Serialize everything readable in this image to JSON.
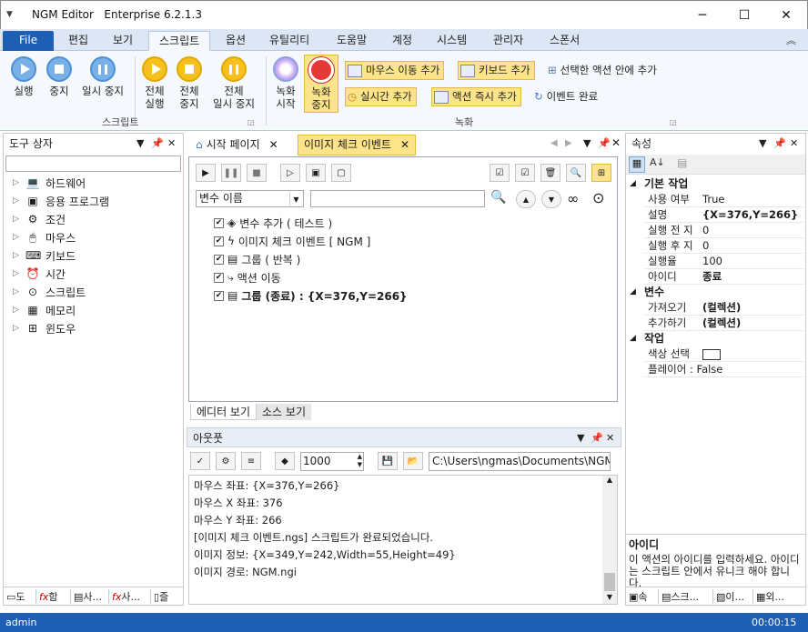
{
  "window": {
    "app_name": "NGM Editor",
    "edition": "Enterprise 6.2.1.3",
    "minimize": "─",
    "maximize": "☐",
    "close": "✕"
  },
  "ribbon_tabs": [
    "File",
    "편집",
    "보기",
    "스크립트",
    "옵션",
    "유틸리티",
    "도움말",
    "계정",
    "시스템",
    "관리자",
    "스폰서"
  ],
  "ribbon": {
    "script_group": {
      "label": "스크립트",
      "run": "실행",
      "stop": "중지",
      "pause": "일시 중지",
      "run_all": [
        "전체",
        "실행"
      ],
      "stop_all": [
        "전체",
        "중지"
      ],
      "pause_all": [
        "전체",
        "일시 중지"
      ]
    },
    "record_group": {
      "label": "녹화",
      "record_start": [
        "녹화",
        "시작"
      ],
      "record_stop": [
        "녹화",
        "중지"
      ],
      "add_mouse_move": "마우스 이동 추가",
      "add_keyboard": "키보드 추가",
      "add_in_selected_action": "선택한 액션 안에 추가",
      "add_realtime": "실시간 추가",
      "add_action_now": "액션 즉시 추가",
      "event_complete": "이벤트 완료"
    }
  },
  "left_panel": {
    "title": "도구 상자",
    "items": [
      "하드웨어",
      "응용 프로그램",
      "조건",
      "마우스",
      "키보드",
      "시간",
      "스크립트",
      "메모리",
      "윈도우"
    ],
    "bottom_tabs": [
      "도",
      "함",
      "사...",
      "사...",
      "즐"
    ]
  },
  "editor": {
    "tabs": [
      "시작 페이지",
      "이미지 체크 이벤트"
    ],
    "variable_select": "변수 이름",
    "actions": [
      {
        "label": "변수 추가 ( 테스트 )",
        "bold": false,
        "icon": "cube-icon"
      },
      {
        "label": "이미지 체크 이벤트 [ NGM ]",
        "bold": false,
        "icon": "lightning-icon"
      },
      {
        "label": "그룹 ( 반복 )",
        "bold": false,
        "icon": "group-icon"
      },
      {
        "label": "액션 이동",
        "bold": false,
        "icon": "move-icon"
      },
      {
        "label": "그룹 (종료) : {X=376,Y=266}",
        "bold": true,
        "icon": "group-icon"
      }
    ],
    "bottom_tabs": [
      "에디터 보기",
      "소스 보기"
    ]
  },
  "output": {
    "title": "아웃풋",
    "line_count": "1000",
    "path": "C:\\Users\\ngmas\\Documents\\NGM6\\",
    "lines": [
      "마우스 좌표: {X=376,Y=266}",
      "마우스 X 좌표: 376",
      "마우스 Y 좌표: 266",
      "[이미지 체크 이벤트.ngs] 스크립트가 완료되었습니다.",
      "이미지 정보: {X=349,Y=242,Width=55,Height=49}",
      "이미지 경로: NGM.ngi"
    ]
  },
  "properties": {
    "title": "속성",
    "categories": [
      {
        "name": "기본 작업",
        "rows": [
          [
            "사용 여부",
            "True",
            false
          ],
          [
            "설명",
            "{X=376,Y=266}",
            true
          ],
          [
            "실행 전 지",
            "0",
            false
          ],
          [
            "실행 후 지",
            "0",
            false
          ],
          [
            "실행율",
            "100",
            false
          ],
          [
            "아이디",
            "종료",
            true
          ]
        ]
      },
      {
        "name": "변수",
        "rows": [
          [
            "가져오기",
            "(컬렉션)",
            true
          ],
          [
            "추가하기",
            "(컬렉션)",
            true
          ]
        ]
      },
      {
        "name": "작업",
        "rows": [
          [
            "색상 선택",
            "",
            false
          ],
          [
            "플레이어 : False",
            "",
            false
          ]
        ]
      }
    ],
    "help_title": "아이디",
    "help_text": "이 액션의 아이디를 입력하세요. 아이디는 스크립트 안에서 유니크 해야 합니다.",
    "bottom_tabs": [
      "속",
      "스크...",
      "이...",
      "외..."
    ]
  },
  "status": {
    "user": "admin",
    "timer": "00:00:15"
  }
}
